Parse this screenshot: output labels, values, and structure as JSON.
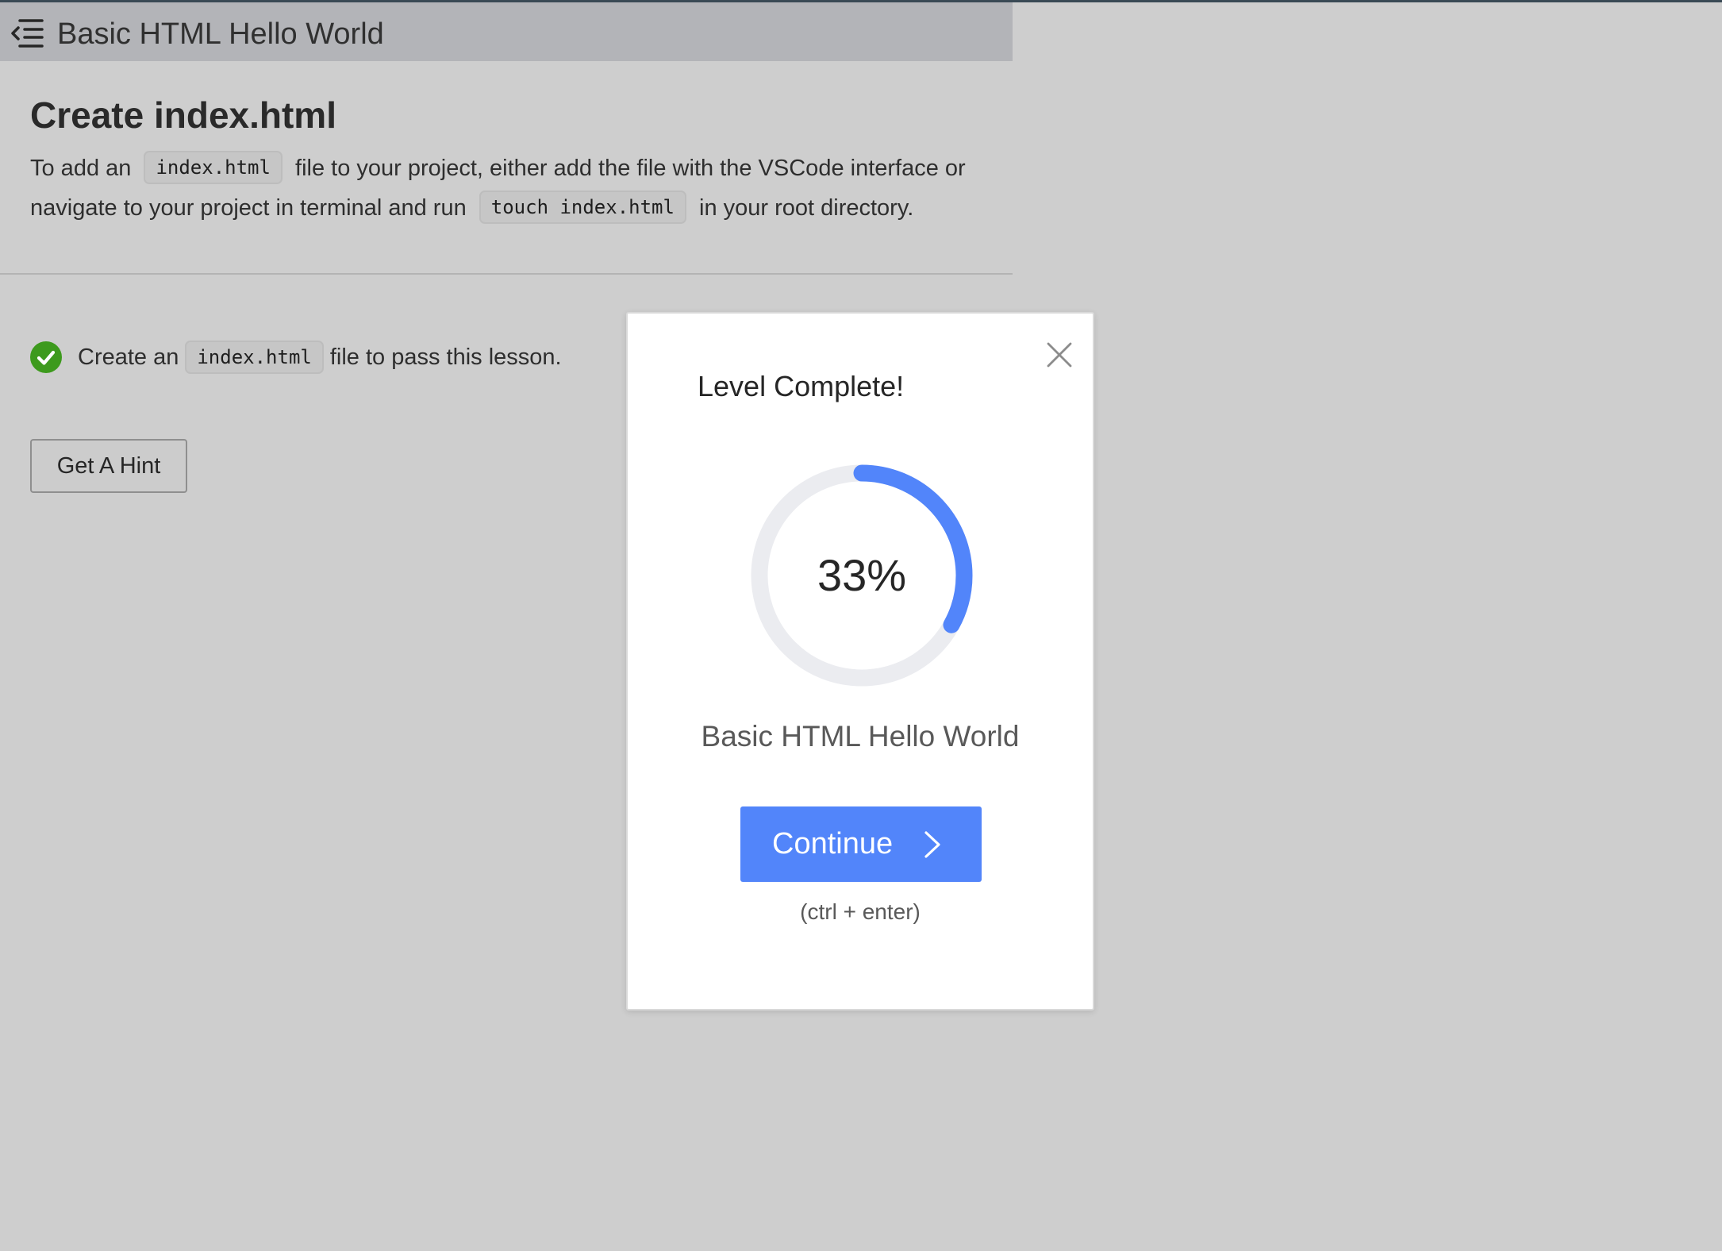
{
  "header": {
    "title": "Basic HTML Hello World",
    "menu_icon": "menu-fold-icon"
  },
  "step": {
    "heading": "Create index.html",
    "description": {
      "part1": "To add an",
      "code1": "index.html",
      "part2": "file to your project, either add the file with the VSCode interface or navigate to your project in terminal and run",
      "code2": "touch index.html",
      "part3": "in your root directory."
    }
  },
  "tests": [
    {
      "status": "passed",
      "status_icon": "check-circle-icon",
      "text_before": "Create an",
      "code": "index.html",
      "text_after": "file to pass this lesson."
    }
  ],
  "hint_button_label": "Get A Hint",
  "modal": {
    "title": "Level Complete!",
    "progress_percent": 33,
    "progress_label": "33%",
    "level_name": "Basic HTML Hello World",
    "continue_label": "Continue",
    "continue_icon": "chevron-right-icon",
    "shortcut_hint": "(ctrl + enter)",
    "close_icon": "close-icon"
  },
  "colors": {
    "overlay_background": "#cecece",
    "titlebar": "#b3b4b8",
    "accent": "#5285fa",
    "success": "#3d9a1d",
    "progress_track": "#ebecf0"
  }
}
